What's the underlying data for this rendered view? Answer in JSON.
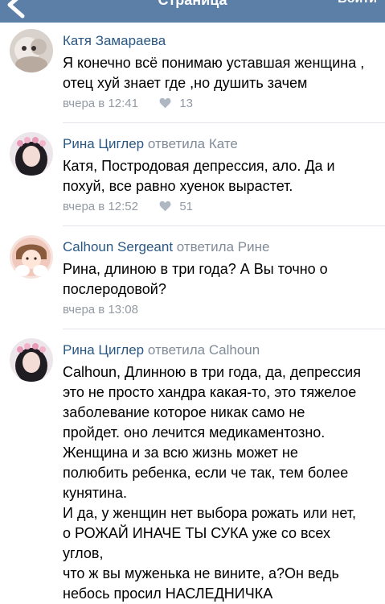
{
  "header": {
    "title": "Страница",
    "login_label": "Войти"
  },
  "comments": [
    {
      "author": "Катя Замараева",
      "reply_to": "",
      "text_lines": [
        "Я конечно всё понимаю уставшая женщина ,",
        "отец хуй знает где ,но душить зачем"
      ],
      "time": "вчера в 12:41",
      "likes": "13"
    },
    {
      "author": "Рина Циглер",
      "reply_to": "ответила Кате",
      "text_lines": [
        "Катя, Постродовая депрессия, ало. Да и",
        "похуй, все равно хуенок вырастет."
      ],
      "time": "вчера в 12:52",
      "likes": "51"
    },
    {
      "author": "Calhoun Sergeant",
      "reply_to": "ответила Рине",
      "text_lines": [
        "Рина, длиною в три года? А Вы точно о",
        "послеродовой?"
      ],
      "time": "вчера в 13:08",
      "likes": ""
    },
    {
      "author": "Рина Циглер",
      "reply_to": "ответила Calhoun",
      "text_lines": [
        "Calhoun, Длинною в три года, да, депрессия",
        "это не просто хандра какая-то, это тяжелое",
        "заболевание которое никак само не",
        "пройдет. оно лечится медикаментозно.",
        "Женщина и за всю жизнь может не",
        "полюбить ребенка, если че так, тем более",
        "кунятина.",
        "И да, у женщин нет выбора рожать или нет,",
        "о РОЖАЙ ИНАЧЕ ТЫ СУКА уже со всех углов,",
        "что ж вы муженька не вините, а?Он ведь",
        "небось просил НАСЛЕДНИЧКА"
      ],
      "time": "",
      "likes": ""
    }
  ],
  "colors": {
    "header_bg": "#5b7fa6",
    "author": "#2a5885",
    "secondary": "#818c99",
    "meta": "#939aa3"
  },
  "icons": {
    "back": "back-arrow-icon",
    "like": "heart-icon"
  }
}
